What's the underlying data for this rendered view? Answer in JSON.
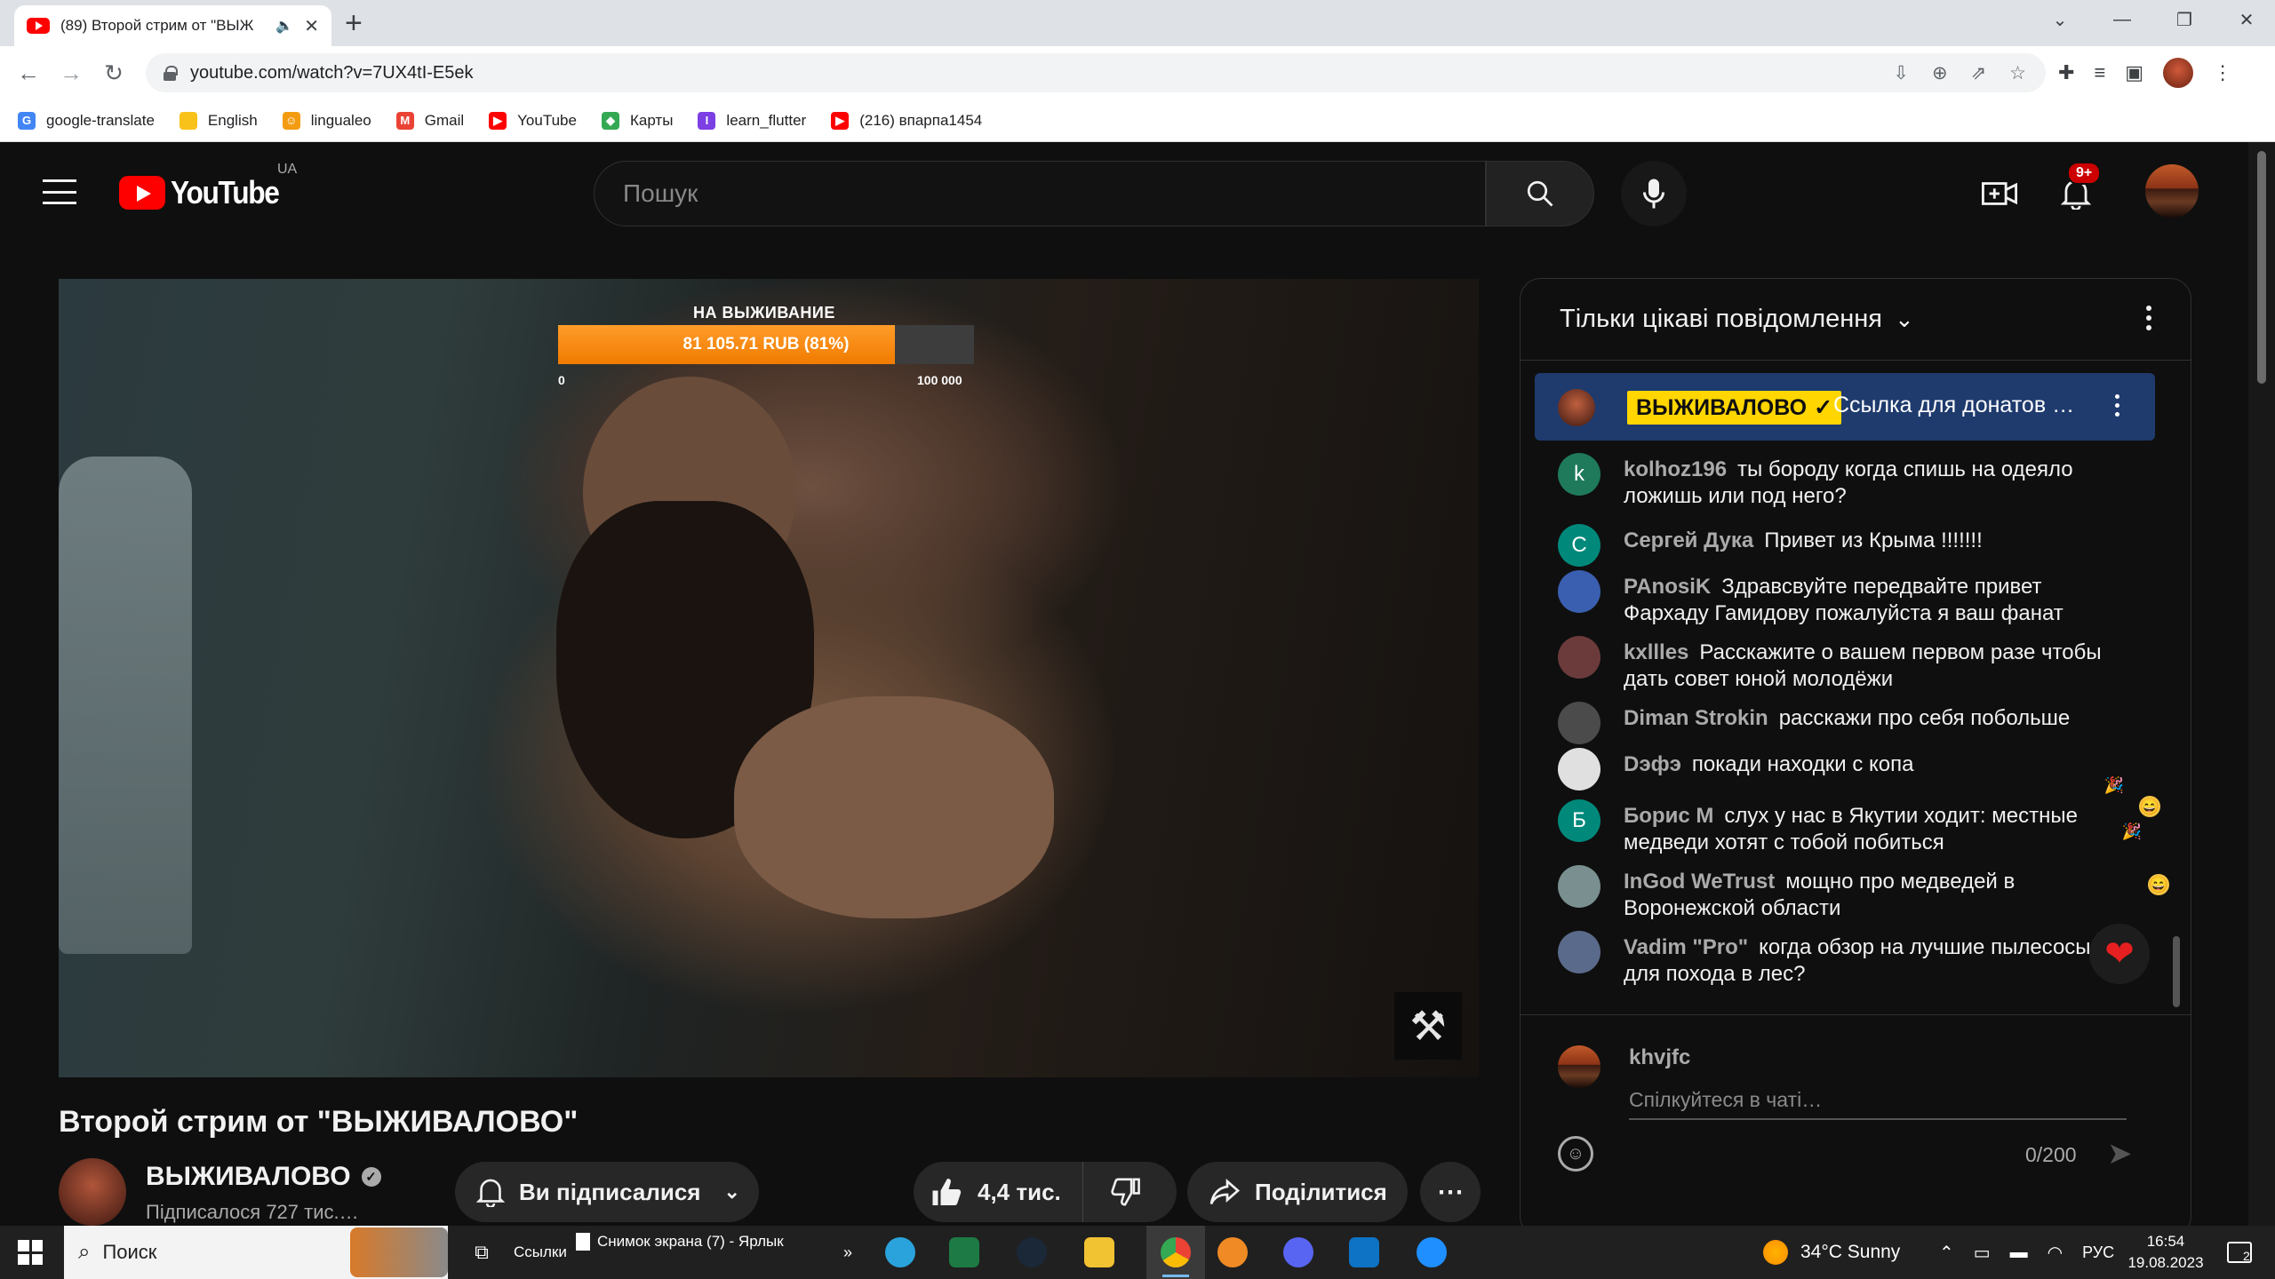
{
  "browser": {
    "tab_title": "(89) Второй стрим от \"ВЫЖИВАЛОВО\"",
    "tab_title_visible": "(89) Второй стрим от \"ВЫЖ",
    "url": "youtube.com/watch?v=7UX4tI-E5ek",
    "bookmarks": [
      {
        "label": "google-translate",
        "icon": "google-translate-icon",
        "color": "#4285f4",
        "glyph": "G"
      },
      {
        "label": "English",
        "icon": "folder-icon",
        "color": "#f9c21a",
        "glyph": ""
      },
      {
        "label": "lingualeo",
        "icon": "lingualeo-icon",
        "color": "#f39c12",
        "glyph": "☺"
      },
      {
        "label": "Gmail",
        "icon": "gmail-icon",
        "color": "#ea4335",
        "glyph": "M"
      },
      {
        "label": "YouTube",
        "icon": "youtube-icon",
        "color": "#ff0000",
        "glyph": "▶"
      },
      {
        "label": "Карты",
        "icon": "maps-icon",
        "color": "#34a853",
        "glyph": "◆"
      },
      {
        "label": "learn_flutter",
        "icon": "flutter-icon",
        "color": "#7b3fe4",
        "glyph": "I"
      },
      {
        "label": "(216) впарпа1454",
        "icon": "youtube-icon",
        "color": "#ff0000",
        "glyph": "▶"
      }
    ]
  },
  "masthead": {
    "logo_text": "YouTube",
    "country_code": "UA",
    "search_placeholder": "Пошук",
    "notification_count": "9+"
  },
  "video": {
    "overlay_title": "НА ВЫЖИВАНИЕ",
    "goal_text": "81 105.71 RUB (81%)",
    "goal_progress": 0.81,
    "goal_min": "0",
    "goal_max": "100 000",
    "title": "Второй стрим от \"ВЫЖИВАЛОВО\""
  },
  "channel": {
    "name": "ВЫЖИВАЛОВО",
    "subscribers": "Підписалося 727 тис.…",
    "subscribe_label": "Ви підписалися",
    "like_count": "4,4 тис.",
    "share_label": "Поділитися"
  },
  "chat": {
    "mode_label": "Тільки цікаві повідомлення",
    "pinned": {
      "author": "ВЫЖИВАЛОВО",
      "text": "Ссылка для донатов https://www.donationalerts.com/r/"
    },
    "messages": [
      {
        "author": "kolhoz196",
        "text": "ты бороду когда спишь на одеяло ложишь или под него?",
        "avatar_letter": "k",
        "avatar_color": "#1e7a5a"
      },
      {
        "author": "Сергей Дука",
        "text": "Привет из Крыма !!!!!!!",
        "avatar_letter": "С",
        "avatar_color": "#00897b"
      },
      {
        "author": "PAnosiK",
        "text": "Здравсвуйте передвайте привет Фархаду Гамидову пожалуйста я ваш фанат",
        "avatar_letter": "",
        "avatar_color": "#3a5fb0"
      },
      {
        "author": "kxllles",
        "text": "Расскажите о вашем первом разе чтобы дать совет юной молодёжи",
        "avatar_letter": "",
        "avatar_color": "#6b3b3b"
      },
      {
        "author": "Diman Strokin",
        "text": "расскажи про себя побольше",
        "avatar_letter": "",
        "avatar_color": "#4b4b4b"
      },
      {
        "author": "Dэфэ",
        "text": "покади находки с копа",
        "avatar_letter": "",
        "avatar_color": "#e0e0e0"
      },
      {
        "author": "Борис М",
        "text": "слух у нас в Якутии ходит: местные медведи хотят с тобой побиться",
        "avatar_letter": "Б",
        "avatar_color": "#00897b"
      },
      {
        "author": "InGod WeTrust",
        "text": "мощно про медведей в Воронежской области",
        "avatar_letter": "",
        "avatar_color": "#7a8f8f"
      },
      {
        "author": "Vadim \"Pro\"",
        "text": "когда обзор на лучшие пылесосы для похода в лес?",
        "avatar_letter": "",
        "avatar_color": "#5a6a8a"
      }
    ],
    "input": {
      "user_name": "khvjfc",
      "placeholder": "Спілкуйтеся в чаті…",
      "char_count": "0/200"
    }
  },
  "taskbar": {
    "search_label": "Поиск",
    "shortcut_label": "Ссылки",
    "screenshot_label": "Снимок экрана (7) - Ярлык",
    "weather": "34°C  Sunny",
    "language": "РУС",
    "time": "16:54",
    "date": "19.08.2023",
    "notification_count": "2"
  }
}
